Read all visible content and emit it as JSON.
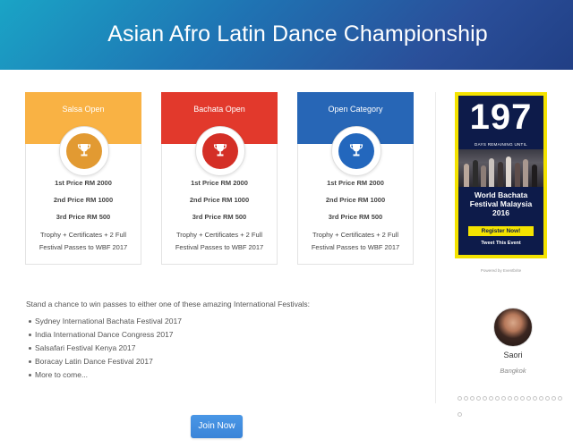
{
  "header": {
    "title": "Asian Afro Latin Dance Championship"
  },
  "colors": {
    "salsa": "#f9b244",
    "bachata": "#e2392c",
    "open": "#2766b6",
    "ad_yellow": "#f4e300",
    "ad_navy": "#0d1b4a",
    "button": "#3a84d8"
  },
  "categories": [
    {
      "title": "Salsa Open",
      "icon": "trophy-icon",
      "prizes": [
        "1st Price RM 2000",
        "2nd Price RM 1000",
        "3rd Price RM 500"
      ],
      "extra_line1": "Trophy + Certificates + 2 Full",
      "extra_line2": "Festival Passes to WBF 2017"
    },
    {
      "title": "Bachata Open",
      "icon": "trophy-icon",
      "prizes": [
        "1st Price RM 2000",
        "2nd Price RM 1000",
        "3rd Price RM 500"
      ],
      "extra_line1": "Trophy + Certificates + 2 Full",
      "extra_line2": "Festival Passes to WBF 2017"
    },
    {
      "title": "Open Category",
      "icon": "trophy-icon",
      "prizes": [
        "1st Price RM 2000",
        "2nd Price RM 1000",
        "3rd Price RM 500"
      ],
      "extra_line1": "Trophy + Certificates + 2 Full",
      "extra_line2": "Festival Passes to WBF 2017"
    }
  ],
  "festivals": {
    "intro": "Stand a chance to win passes to either one of these amazing International Festivals:",
    "items": [
      "Sydney International Bachata Festival 2017",
      "India International Dance Congress 2017",
      "Salsafari Festival Kenya 2017",
      "Boracay Latin Dance Festival 2017",
      "More to come..."
    ]
  },
  "join_button": "Join Now",
  "countdown_ad": {
    "count": "197",
    "days_text": "DAYS REMAINING UNTIL",
    "event_line1": "World Bachata",
    "event_line2": "Festival Malaysia",
    "event_line3": "2016",
    "register": "Register Now!",
    "tweet": "Tweet This Event",
    "powered_by": "Powered by Eventbrite"
  },
  "testimonial": {
    "name": "Saori",
    "city": "Bangkok"
  },
  "carousel": {
    "dot_count": 18
  }
}
